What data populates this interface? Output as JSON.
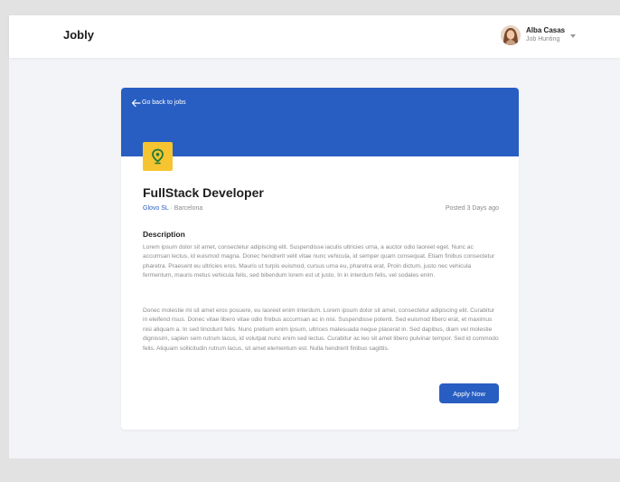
{
  "app": {
    "brand": "Jobly"
  },
  "user": {
    "name": "Alba Casas",
    "status": "Job Hunting",
    "avatar_icon": "avatar-photo"
  },
  "banner": {
    "color": "#285ec2",
    "back_label": "Go back to jobs"
  },
  "job": {
    "title": "FullStack Developer",
    "company": "Glovo SL",
    "location_sep": " · Barcelona",
    "posted": "Posted 3 Days ago",
    "logo_icon": "location-pin-icon",
    "logo_color": "#f5c430"
  },
  "description": {
    "heading": "Description",
    "paragraphs": [
      "Lorem ipsum dolor sit amet, consectetur adipiscing elit. Suspendisse iaculis ultricies urna, a auctor odio laoreet eget. Nunc ac accumsan lectus, id euismod magna. Donec hendrerit velit vitae nunc vehicula, id semper quam consequat. Etiam finibus consectetur pharetra. Praesent eu ultricies eros. Mauris ut turpis euismod, cursus urna eu, pharetra erat. Proin dictum, justo nec vehicula fermentum, mauris metus vehicula felis, sed bibendum lorem est ut justo. In in interdum felis, vel sodales enim.",
      "Donec molestie mi sit amet eros posuere, eu laoreet enim interdum. Lorem ipsum dolor sit amet, consectetur adipiscing elit. Curabitur in eleifend risus. Donec vitae libero vitae odio finibus accumsan ac in nisi. Suspendisse potenti. Sed euismod libero erat, et maximus nisi aliquam a. In sed tincidunt felis. Nunc pretium enim ipsum, ultrices malesuada neque placerat in. Sed dapibus, diam vel molestie dignissim, sapien sem rutrum lacus, id volutpat nunc enim sed lectus. Curabitur ac leo sit amet libero pulvinar tempor. Sed id commodo felis. Aliquam sollicitudin rutrum lacus, sit amet elementum est. Nulla hendrerit finibus sagittis."
    ]
  },
  "actions": {
    "apply_label": "Apply Now"
  }
}
